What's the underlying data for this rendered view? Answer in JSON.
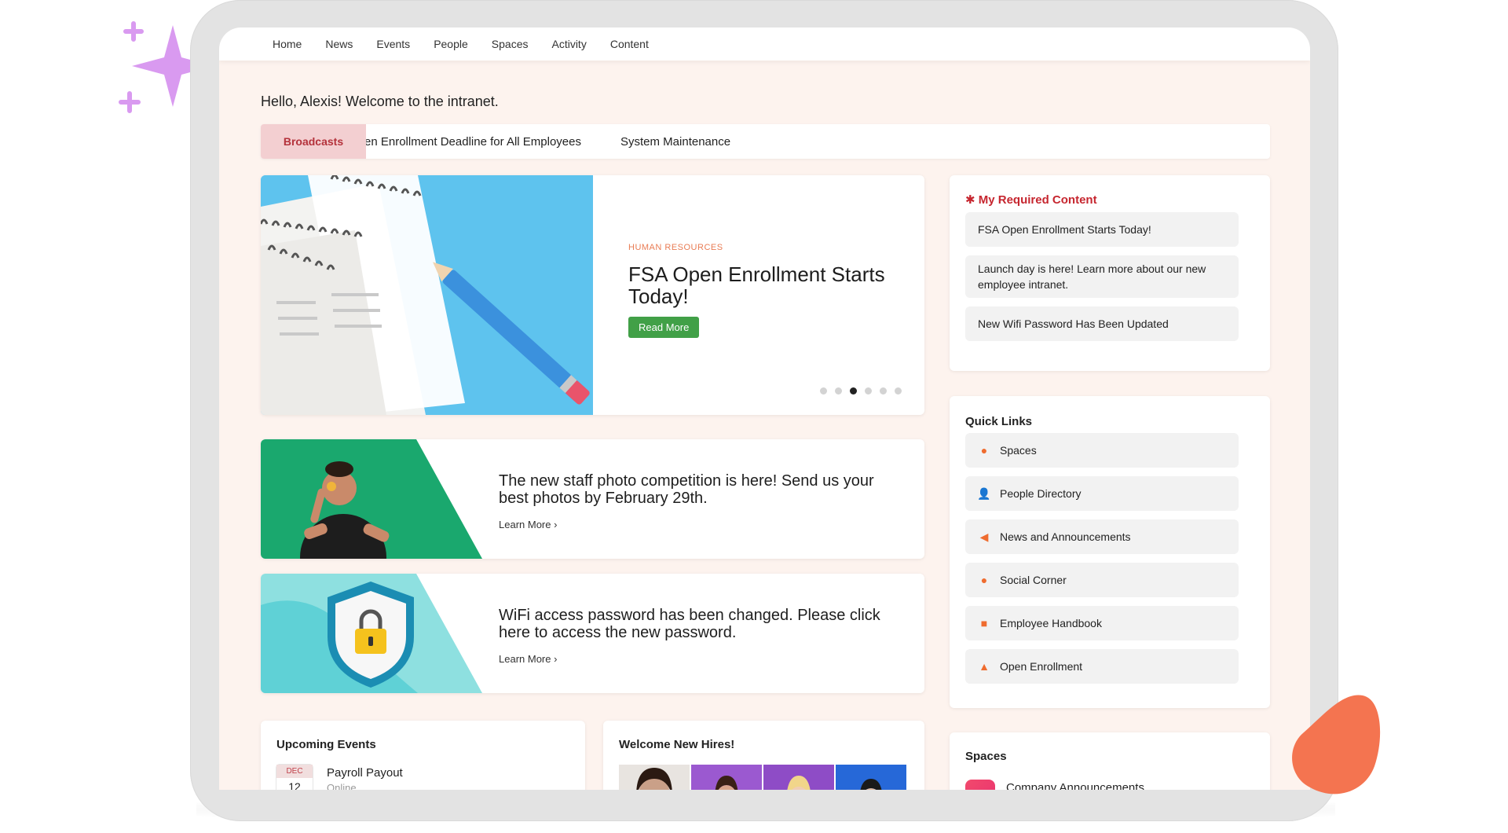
{
  "nav": [
    "Home",
    "News",
    "Events",
    "People",
    "Spaces",
    "Activity",
    "Content"
  ],
  "greeting": "Hello, Alexis! Welcome to the intranet.",
  "broadcasts": {
    "label": "Broadcasts",
    "items": [
      "Open Enrollment Deadline for All Employees",
      "System Maintenance"
    ]
  },
  "hero": {
    "category": "HUMAN RESOURCES",
    "title": "FSA Open Enrollment Starts Today!",
    "button": "Read More",
    "slides": 6,
    "active_slide": 3
  },
  "news": [
    {
      "text": "The new staff photo competition is here! Send us your best photos by February 29th.",
      "link": "Learn More"
    },
    {
      "text": "WiFi access password has been changed. Please click here to access the new password.",
      "link": "Learn More"
    }
  ],
  "required": {
    "title": "My Required Content",
    "items": [
      "FSA Open Enrollment Starts Today!",
      "Launch day is here! Learn more about our new employee intranet.",
      "New Wifi Password Has Been Updated"
    ]
  },
  "quick_links": {
    "title": "Quick Links",
    "items": [
      {
        "label": "Spaces",
        "icon": "globe-icon"
      },
      {
        "label": "People Directory",
        "icon": "person-icon"
      },
      {
        "label": "News and Announcements",
        "icon": "megaphone-icon"
      },
      {
        "label": "Social Corner",
        "icon": "chat-icon"
      },
      {
        "label": "Employee Handbook",
        "icon": "book-icon"
      },
      {
        "label": "Open Enrollment",
        "icon": "bell-icon"
      }
    ]
  },
  "events": {
    "title": "Upcoming Events",
    "items": [
      {
        "month": "DEC",
        "day": "12",
        "name": "Payroll Payout",
        "location": "Online"
      }
    ]
  },
  "hires": {
    "title": "Welcome New Hires!"
  },
  "spaces": {
    "title": "Spaces",
    "items": [
      "Company Announcements"
    ]
  },
  "colors": {
    "accent": "#ef6c2f",
    "brand_green": "#41a047",
    "broadcast_bg": "#f3cfd1",
    "required_red": "#c6262f",
    "screen_bg": "#fdf3ee"
  }
}
